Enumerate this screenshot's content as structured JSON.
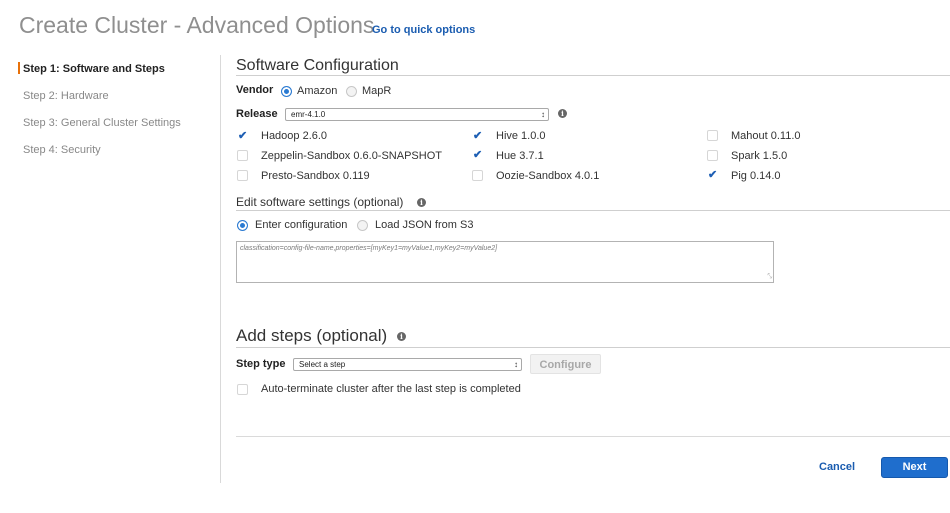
{
  "page": {
    "title": "Create Cluster - Advanced Options",
    "quick_link": "Go to quick options"
  },
  "steps": [
    {
      "label": "Step 1: Software and Steps",
      "active": true
    },
    {
      "label": "Step 2: Hardware",
      "active": false
    },
    {
      "label": "Step 3: General Cluster Settings",
      "active": false
    },
    {
      "label": "Step 4: Security",
      "active": false
    }
  ],
  "software": {
    "title": "Software Configuration",
    "vendor_label": "Vendor",
    "vendor_options": [
      {
        "label": "Amazon",
        "selected": true
      },
      {
        "label": "MapR",
        "selected": false
      }
    ],
    "release_label": "Release",
    "release_value": "emr-4.1.0",
    "apps": [
      {
        "label": "Hadoop 2.6.0",
        "checked": true
      },
      {
        "label": "Zeppelin-Sandbox 0.6.0-SNAPSHOT",
        "checked": false
      },
      {
        "label": "Presto-Sandbox 0.119",
        "checked": false
      },
      {
        "label": "Hive 1.0.0",
        "checked": true
      },
      {
        "label": "Hue 3.7.1",
        "checked": true
      },
      {
        "label": "Oozie-Sandbox 4.0.1",
        "checked": false
      },
      {
        "label": "Mahout 0.11.0",
        "checked": false
      },
      {
        "label": "Spark 1.5.0",
        "checked": false
      },
      {
        "label": "Pig 0.14.0",
        "checked": true
      }
    ]
  },
  "edit_settings": {
    "title": "Edit software settings (optional)",
    "options": [
      {
        "label": "Enter configuration",
        "selected": true
      },
      {
        "label": "Load JSON from S3",
        "selected": false
      }
    ],
    "placeholder": "classification=config-file-name,properties=[myKey1=myValue1,myKey2=myValue2]"
  },
  "add_steps": {
    "title": "Add steps (optional)",
    "step_type_label": "Step type",
    "step_select_value": "Select a step",
    "configure_label": "Configure",
    "auto_terminate_label": "Auto-terminate cluster after the last step is completed",
    "auto_terminate_checked": false
  },
  "footer": {
    "cancel_label": "Cancel",
    "next_label": "Next"
  },
  "colors": {
    "accent": "#1f6ecd",
    "link": "#1a5cb0",
    "active_step_marker": "#e8710a"
  },
  "icons": {
    "info": "info-icon",
    "check": "check-icon",
    "select_arrow": "updown-arrow-icon"
  }
}
